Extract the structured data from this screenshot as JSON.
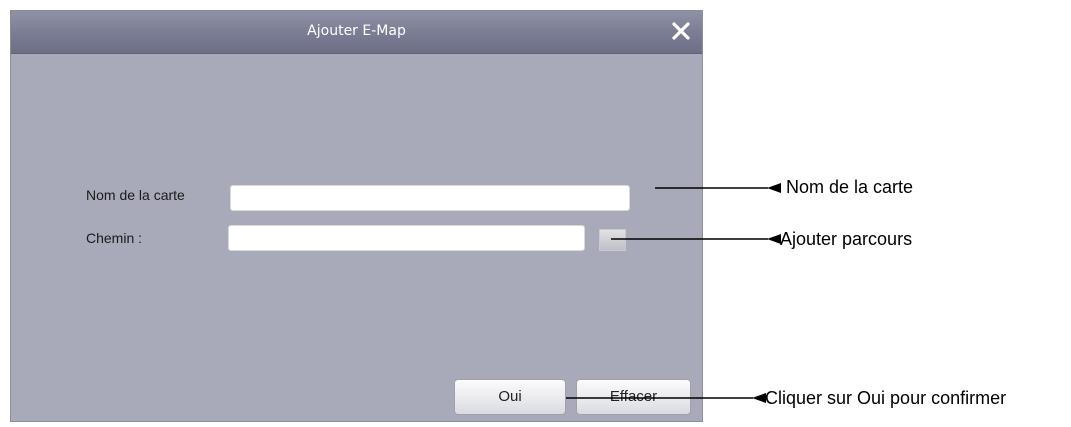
{
  "dialog": {
    "title": "Ajouter E-Map",
    "close_icon": "close-icon",
    "fields": {
      "map_name": {
        "label": "Nom de la carte",
        "value": "",
        "placeholder": ""
      },
      "path": {
        "label": "Chemin :",
        "value": "",
        "placeholder": ""
      }
    },
    "browse_icon": "browse-icon",
    "buttons": {
      "ok": "Oui",
      "clear": "Effacer"
    }
  },
  "annotations": {
    "map_name": "Nom de la carte",
    "add_path": "Ajouter parcours",
    "confirm": "Cliquer sur Oui pour confirmer"
  },
  "colors": {
    "dialog_bg": "#a9aab9",
    "titlebar": "#7a7c93",
    "title_text": "#ffffff"
  }
}
